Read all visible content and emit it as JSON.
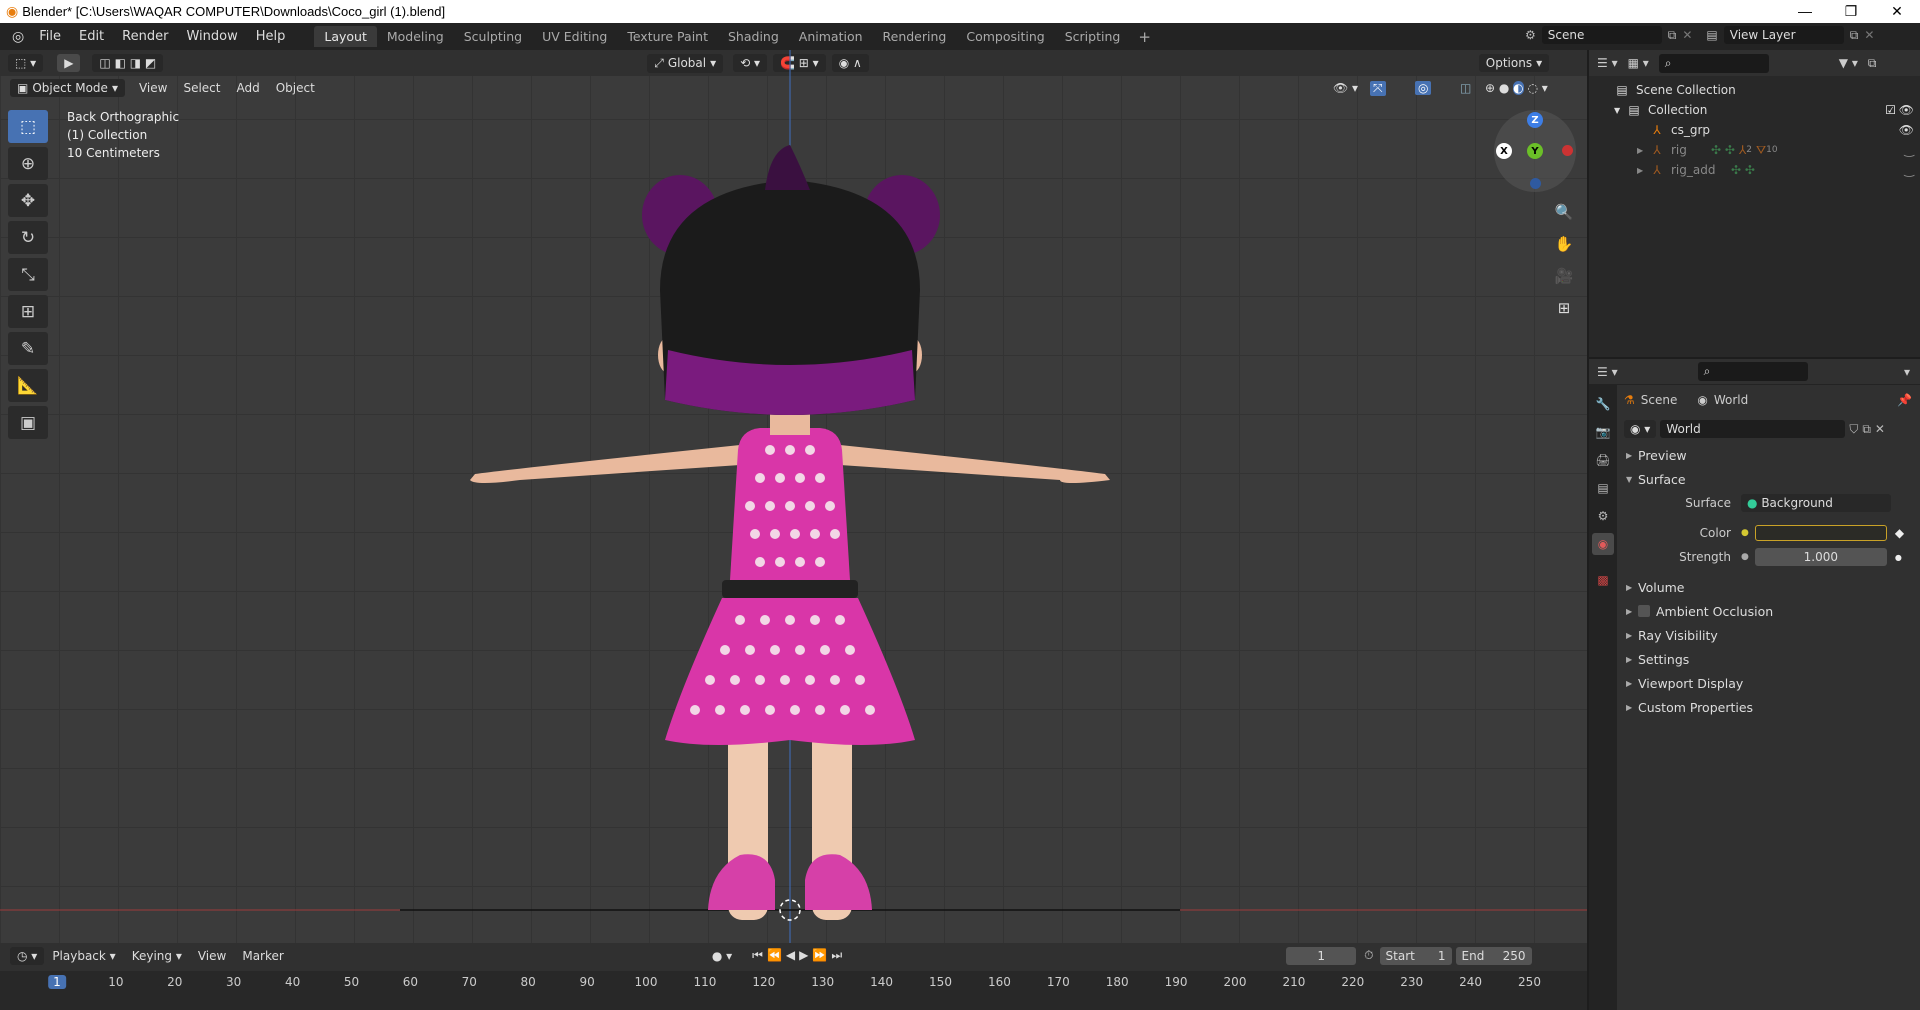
{
  "titlebar": {
    "title": "Blender* [C:\\Users\\WAQAR COMPUTER\\Downloads\\Coco_girl (1).blend]",
    "minimize": "—",
    "maximize": "❐",
    "close": "✕"
  },
  "menu": [
    "File",
    "Edit",
    "Render",
    "Window",
    "Help"
  ],
  "workspaces": [
    "Layout",
    "Modeling",
    "Sculpting",
    "UV Editing",
    "Texture Paint",
    "Shading",
    "Animation",
    "Rendering",
    "Compositing",
    "Scripting"
  ],
  "workspace_add": "+",
  "scene": {
    "name": "Scene",
    "view_layer": "View Layer"
  },
  "viewport": {
    "mode": "Object Mode",
    "menus": [
      "View",
      "Select",
      "Add",
      "Object"
    ],
    "transform": "Global",
    "options": "Options",
    "info": {
      "view": "Back Orthographic",
      "collection": "(1) Collection",
      "scale": "10 Centimeters"
    },
    "axes": {
      "z": "Z",
      "y": "Y",
      "x": "X"
    }
  },
  "outliner": {
    "scene_collection": "Scene Collection",
    "collection": "Collection",
    "items": [
      "cs_grp",
      "rig",
      "rig_add"
    ],
    "rig_badges": [
      "2",
      "10"
    ]
  },
  "properties": {
    "breadcrumb_scene": "Scene",
    "breadcrumb_world": "World",
    "world_name": "World",
    "panels": [
      "Preview",
      "Surface"
    ],
    "surface_label": "Surface",
    "surface_value": "Background",
    "color_label": "Color",
    "strength_label": "Strength",
    "strength_value": "1.000",
    "subpanels": [
      "Volume",
      "Ambient Occlusion",
      "Ray Visibility",
      "Settings",
      "Viewport Display",
      "Custom Properties"
    ]
  },
  "timeline": {
    "menus": [
      "Playback",
      "Keying",
      "View",
      "Marker"
    ],
    "current_frame": "1",
    "start_label": "Start",
    "start_value": "1",
    "end_label": "End",
    "end_value": "250",
    "ruler": [
      "1",
      "10",
      "20",
      "30",
      "40",
      "50",
      "60",
      "70",
      "80",
      "90",
      "100",
      "110",
      "120",
      "130",
      "140",
      "150",
      "160",
      "170",
      "180",
      "190",
      "200",
      "210",
      "220",
      "230",
      "240",
      "250"
    ]
  },
  "colors": {
    "accent": "#4772b3",
    "dress": "#d936a8",
    "hair": "#7a1b7e",
    "skin": "#f0c4a6"
  }
}
